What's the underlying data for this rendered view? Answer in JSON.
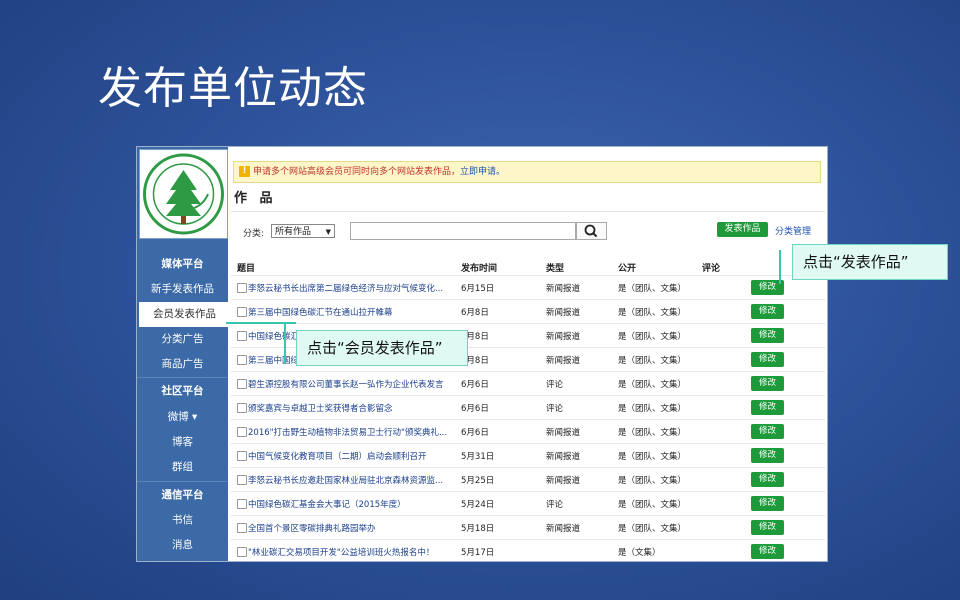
{
  "slide_title": "发布单位动态",
  "sidebar": {
    "logo_alt": "绿色碳汇基金会",
    "items": [
      {
        "label": "媒体平台",
        "kind": "head"
      },
      {
        "label": "新手发表作品",
        "kind": "item"
      },
      {
        "label": "会员发表作品",
        "kind": "active"
      },
      {
        "label": "分类广告",
        "kind": "item"
      },
      {
        "label": "商品广告",
        "kind": "item"
      },
      {
        "label": "社区平台",
        "kind": "head"
      },
      {
        "label": "微博 ▾",
        "kind": "item"
      },
      {
        "label": "博客",
        "kind": "item"
      },
      {
        "label": "群组",
        "kind": "item"
      },
      {
        "label": "通信平台",
        "kind": "head"
      },
      {
        "label": "书信",
        "kind": "item"
      },
      {
        "label": "消息",
        "kind": "item"
      }
    ]
  },
  "notice": {
    "text": "申请多个网站高级会员可同时向多个网站发表作品，",
    "link": "立即申请。"
  },
  "section_title": "作 品",
  "filter": {
    "label": "分类:",
    "selected": "所有作品"
  },
  "toolbar": {
    "publish_label": "发表作品",
    "category_manage": "分类管理"
  },
  "table": {
    "headers": {
      "title": "题目",
      "date": "发布时间",
      "type": "类型",
      "public": "公开",
      "comment": "评论"
    },
    "edit_label": "修改",
    "rows": [
      {
        "title": "李怒云秘书长出席第二届绿色经济与应对气候变化...",
        "date": "6月15日",
        "type": "新闻报道",
        "public": "是（团队、文集）"
      },
      {
        "title": "第三届中国绿色碳汇节在通山拉开帷幕",
        "date": "6月8日",
        "type": "新闻报道",
        "public": "是（团队、文集）"
      },
      {
        "title": "中国绿色碳汇",
        "date": "6月8日",
        "type": "新闻报道",
        "public": "是（团队、文集）"
      },
      {
        "title": "第三届中国绿",
        "date": "6月8日",
        "type": "新闻报道",
        "public": "是（团队、文集）"
      },
      {
        "title": "碧生源控股有限公司董事长赵一弘作为企业代表发言",
        "date": "6月6日",
        "type": "评论",
        "public": "是（团队、文集）"
      },
      {
        "title": "颁奖嘉宾与卓越卫士奖获得者合影留念",
        "date": "6月6日",
        "type": "评论",
        "public": "是（团队、文集）"
      },
      {
        "title": "2016\"打击野生动植物非法贸易卫士行动\"颁奖典礼...",
        "date": "6月6日",
        "type": "新闻报道",
        "public": "是（团队、文集）"
      },
      {
        "title": "中国气候变化教育项目（二期）启动会顺利召开",
        "date": "5月31日",
        "type": "新闻报道",
        "public": "是（团队、文集）"
      },
      {
        "title": "李怒云秘书长应邀赴国家林业局驻北京森林资源监...",
        "date": "5月25日",
        "type": "新闻报道",
        "public": "是（团队、文集）"
      },
      {
        "title": "中国绿色碳汇基金会大事记（2015年度）",
        "date": "5月24日",
        "type": "评论",
        "public": "是（团队、文集）"
      },
      {
        "title": "全国首个景区零碳排典礼路园举办",
        "date": "5月18日",
        "type": "新闻报道",
        "public": "是（团队、文集）"
      },
      {
        "title": "\"林业碳汇交易项目开发\"公益培训班火热报名中！",
        "date": "5月17日",
        "type": "",
        "public": "是（文集）"
      }
    ]
  },
  "callouts": {
    "publish": "点击“发表作品”",
    "member": "点击“会员发表作品”"
  },
  "colors": {
    "accent_green": "#1e9a3b",
    "sidebar_blue": "#3b6aa6",
    "callout_line": "#37c7ae"
  }
}
